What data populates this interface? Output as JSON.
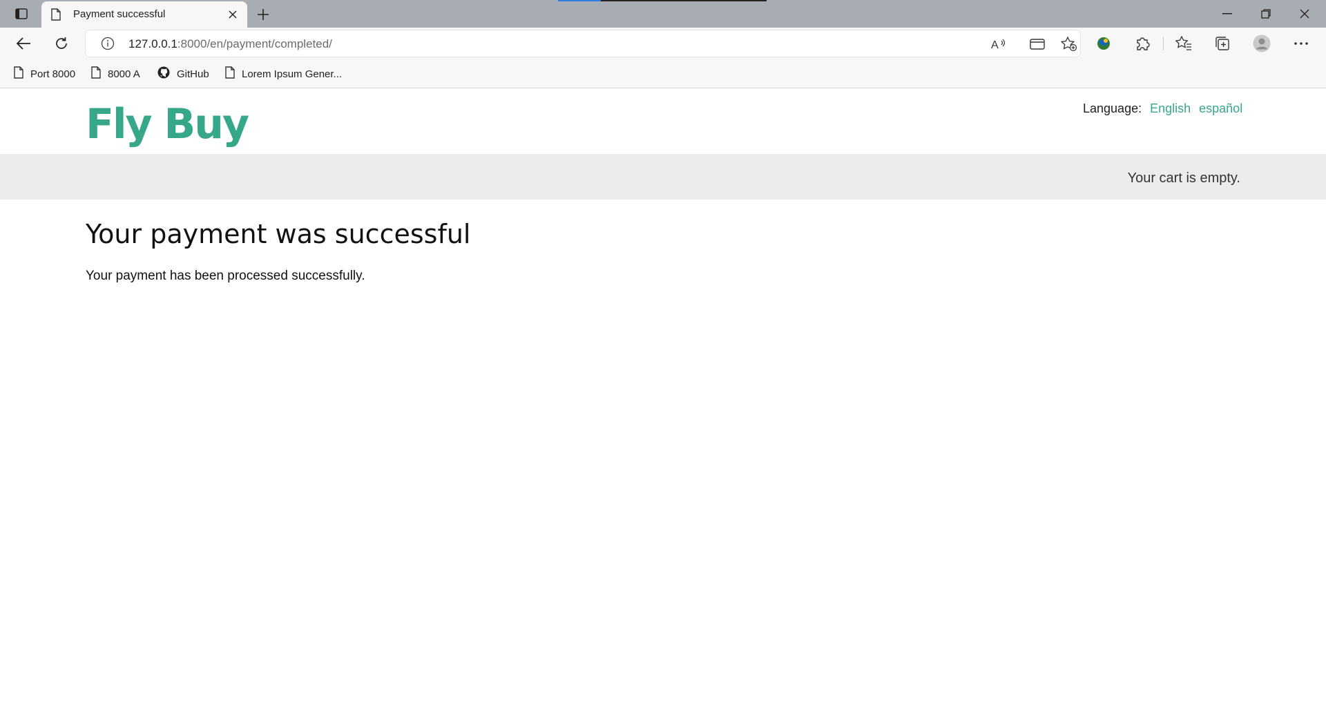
{
  "browser": {
    "tab_title": "Payment successful",
    "url_host": "127.0.0.1",
    "url_rest": ":8000/en/payment/completed/",
    "bookmarks": [
      {
        "label": "Port 8000",
        "icon": "page-icon"
      },
      {
        "label": "8000 A",
        "icon": "page-icon"
      },
      {
        "label": "GitHub",
        "icon": "github-icon"
      },
      {
        "label": "Lorem Ipsum Gener...",
        "icon": "page-icon"
      }
    ]
  },
  "site": {
    "logo": "Fly Buy",
    "language_label": "Language:",
    "languages": [
      "English",
      "español"
    ],
    "cart_text": "Your cart is empty.",
    "accent_color": "#36a889"
  },
  "main": {
    "heading": "Your payment was successful",
    "message": "Your payment has been processed successfully."
  }
}
